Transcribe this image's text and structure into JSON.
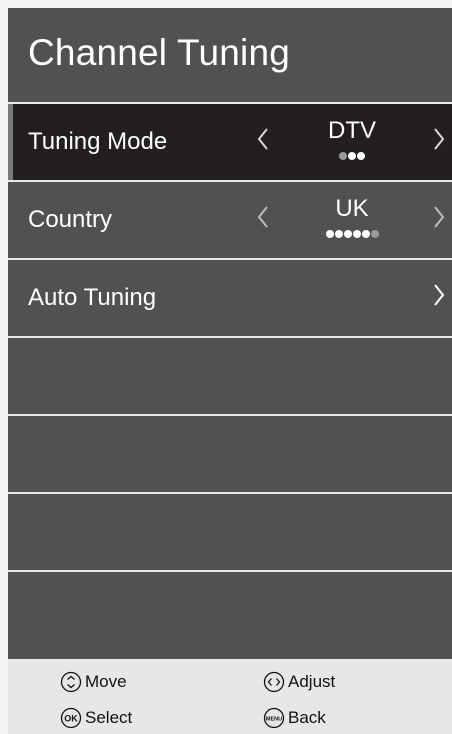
{
  "header": {
    "title": "Channel Tuning"
  },
  "menu": {
    "items": [
      {
        "label": "Tuning Mode",
        "value": "DTV",
        "option_count": 3,
        "active_option_index": 0,
        "left_arrow": "chevron-left-icon",
        "right_arrow": "chevron-right-icon"
      },
      {
        "label": "Country",
        "value": "UK",
        "option_count": 6,
        "active_option_index": 5,
        "left_arrow": "chevron-left-icon",
        "right_arrow": "chevron-right-icon"
      },
      {
        "label": "Auto Tuning",
        "right_arrow": "chevron-right-icon"
      }
    ],
    "empty_rows": 4,
    "selected_index": 0
  },
  "footer": {
    "move_label": "Move",
    "adjust_label": "Adjust",
    "select_label": "Select",
    "back_label": "Back",
    "ok_icon_text": "OK",
    "menu_icon_text": "MENU"
  },
  "colors": {
    "panel": "#505152",
    "selected_row": "#231f20",
    "footer": "#e7e7e7",
    "text": "#ffffff",
    "dot_active": "#9a9a9a"
  }
}
